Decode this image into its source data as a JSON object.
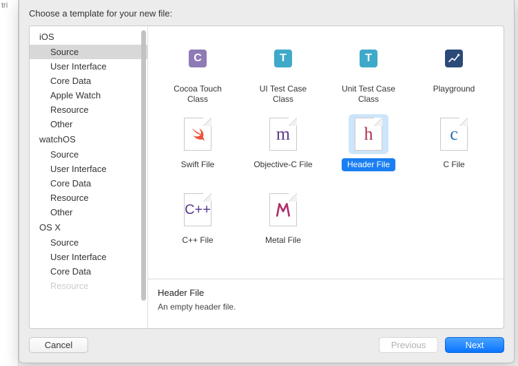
{
  "left_stub": "tri",
  "header": {
    "title": "Choose a template for your new file:"
  },
  "sidebar": {
    "platforms": [
      {
        "name": "iOS",
        "key": "ios",
        "categories": [
          {
            "label": "Source",
            "selected": true
          },
          {
            "label": "User Interface"
          },
          {
            "label": "Core Data"
          },
          {
            "label": "Apple Watch"
          },
          {
            "label": "Resource"
          },
          {
            "label": "Other"
          }
        ]
      },
      {
        "name": "watchOS",
        "key": "watchos",
        "categories": [
          {
            "label": "Source"
          },
          {
            "label": "User Interface"
          },
          {
            "label": "Core Data"
          },
          {
            "label": "Resource"
          },
          {
            "label": "Other"
          }
        ]
      },
      {
        "name": "OS X",
        "key": "osx",
        "categories": [
          {
            "label": "Source"
          },
          {
            "label": "User Interface"
          },
          {
            "label": "Core Data"
          },
          {
            "label": "Resource"
          }
        ]
      }
    ]
  },
  "templates": [
    {
      "key": "cocoa-touch-class",
      "label": "Cocoa Touch Class",
      "icon": "box-c-purple"
    },
    {
      "key": "ui-test-case-class",
      "label": "UI Test Case Class",
      "icon": "box-t-teal"
    },
    {
      "key": "unit-test-case-class",
      "label": "Unit Test Case Class",
      "icon": "box-t-teal"
    },
    {
      "key": "playground",
      "label": "Playground",
      "icon": "box-playground"
    },
    {
      "key": "swift-file",
      "label": "Swift File",
      "icon": "swift"
    },
    {
      "key": "objective-c-file",
      "label": "Objective-C File",
      "icon": "letter-m-purple"
    },
    {
      "key": "header-file",
      "label": "Header File",
      "icon": "letter-h-crim",
      "selected": true
    },
    {
      "key": "c-file",
      "label": "C File",
      "icon": "letter-c-blue"
    },
    {
      "key": "cpp-file",
      "label": "C++ File",
      "icon": "letter-cpp-purple"
    },
    {
      "key": "metal-file",
      "label": "Metal File",
      "icon": "metal"
    }
  ],
  "description": {
    "title": "Header File",
    "text": "An empty header file."
  },
  "footer": {
    "cancel": "Cancel",
    "previous": "Previous",
    "next": "Next"
  }
}
